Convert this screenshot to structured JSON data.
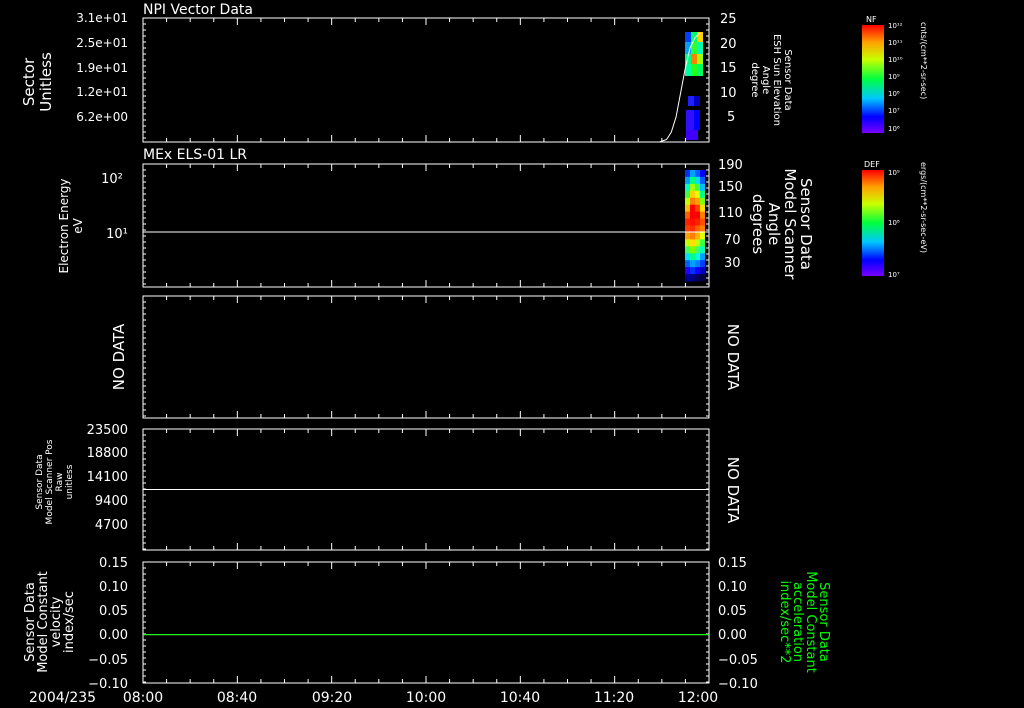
{
  "footer": {
    "date": "2004/235",
    "time_ticks": [
      "08:00",
      "08:40",
      "09:20",
      "10:00",
      "10:40",
      "11:20",
      "12:00"
    ]
  },
  "colors": {
    "foreground": "#ffffff",
    "background": "#000000",
    "green_trace": "#00ff00"
  },
  "chart_data": [
    {
      "id": "panel-npi",
      "type": "heatmap",
      "title": "NPI Vector Data",
      "ylabel_left": [
        "Sector",
        "Unitless"
      ],
      "ylabel_right": [
        "Sensor Data",
        "ESH Sun Elevation",
        "Angle",
        "degree"
      ],
      "left_ticks": [
        "3.1e+01",
        "2.5e+01",
        "1.9e+01",
        "1.2e+01",
        "6.2e+00"
      ],
      "right_ticks": [
        "25",
        "20",
        "15",
        "10",
        "5"
      ],
      "right_ylim": [
        0,
        25
      ],
      "line": {
        "x": [
          "11:39",
          "11:42",
          "11:44",
          "11:46",
          "11:48",
          "11:50",
          "11:52",
          "11:54",
          "11:56"
        ],
        "y": [
          0,
          0.5,
          2,
          5,
          10,
          15,
          19,
          21,
          22
        ]
      },
      "colorbar": {
        "label": "NF",
        "units": "cnts/(cm**2-sr-sec)",
        "ticks": [
          "10¹²",
          "10¹¹",
          "10¹⁰",
          "10⁹",
          "10⁸",
          "10⁷",
          "10⁶"
        ]
      }
    },
    {
      "id": "panel-els",
      "type": "heatmap",
      "title": "MEx ELS-01 LR",
      "ylabel_left": [
        "Electron Energy",
        "eV"
      ],
      "ylabel_right": [
        "Sensor Data",
        "Model Scanner",
        "Angle",
        "degrees"
      ],
      "left_ticks": [
        "10²",
        "10¹"
      ],
      "right_ticks": [
        "190",
        "150",
        "110",
        "70",
        "30"
      ],
      "right_ylim": [
        0,
        190
      ],
      "line": {
        "x": [
          "08:00",
          "12:00"
        ],
        "y": [
          85,
          85
        ]
      },
      "colorbar": {
        "label": "DEF",
        "units": "ergs/(cm**2-sr-sec-eV)",
        "ticks": [
          "10⁹",
          "10⁸",
          "10⁷"
        ]
      }
    },
    {
      "id": "panel-nodata",
      "type": "line",
      "left_label": "NO DATA",
      "right_label": "NO DATA"
    },
    {
      "id": "panel-scanner-pos",
      "type": "line",
      "ylabel_left": [
        "Sensor Data",
        "Model Scanner Pos",
        "Raw",
        "unitless"
      ],
      "right_label": "NO DATA",
      "ticks": [
        "23500",
        "18800",
        "14100",
        "9400",
        "4700"
      ],
      "ylim": [
        0,
        23500
      ],
      "line": {
        "x": [
          "08:00",
          "12:00"
        ],
        "y": [
          11750,
          11750
        ]
      }
    },
    {
      "id": "panel-constant",
      "type": "line",
      "ylabel_left": [
        "Sensor Data",
        "Model Constant",
        "velocity",
        "index/sec"
      ],
      "ylabel_right": [
        "Sensor Data",
        "Model Constant",
        "acceleration",
        "index/sec**2"
      ],
      "ticks": [
        "0.15",
        "0.10",
        "0.05",
        "0.00",
        "−0.05",
        "−0.10"
      ],
      "ylim": [
        -0.1,
        0.15
      ],
      "series": [
        {
          "x": [
            "08:00",
            "12:00"
          ],
          "y": [
            0,
            0
          ],
          "color": "#ffffff"
        },
        {
          "x": [
            "08:00",
            "12:00"
          ],
          "y": [
            0,
            0
          ],
          "color": "#00ff00"
        }
      ]
    }
  ]
}
